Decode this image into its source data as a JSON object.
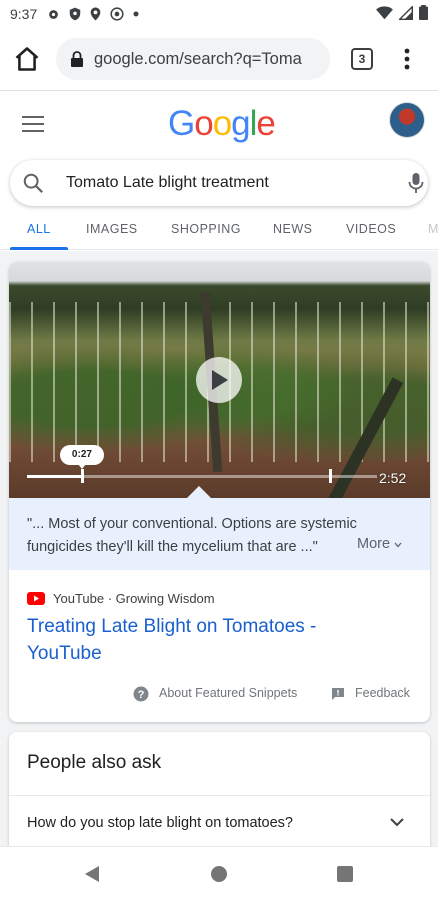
{
  "status_bar": {
    "time": "9:37",
    "left_icons": [
      "gear-icon",
      "shield-icon",
      "location-icon",
      "accessibility-icon",
      "dot-icon"
    ],
    "right_icons": [
      "wifi-icon",
      "signal-icon",
      "battery-icon"
    ]
  },
  "browser": {
    "url": "google.com/search?q=Toma",
    "tab_count": "3",
    "icons": [
      "home-icon",
      "lock-icon",
      "more-vert-icon"
    ]
  },
  "google": {
    "logo_letters": [
      "G",
      "o",
      "o",
      "g",
      "l",
      "e"
    ],
    "search_query": "Tomato Late blight treatment"
  },
  "tabs": [
    {
      "label": "ALL",
      "active": true
    },
    {
      "label": "IMAGES",
      "active": false
    },
    {
      "label": "SHOPPING",
      "active": false
    },
    {
      "label": "NEWS",
      "active": false
    },
    {
      "label": "VIDEOS",
      "active": false
    },
    {
      "label": "M",
      "active": false
    }
  ],
  "featured_snippet": {
    "video": {
      "current_time": "0:27",
      "duration": "2:52",
      "progress_fraction": 0.157,
      "clip_end_fraction": 0.865
    },
    "snippet_text_line1": "\"... Most of your conventional. Options are systemic",
    "snippet_text_line2": "fungicides they'll kill the mycelium that are ...\"",
    "more_label": "More",
    "source": "YouTube · Growing Wisdom",
    "title_line1": "Treating Late Blight on Tomatoes -",
    "title_line2": "YouTube",
    "about_label": "About Featured Snippets",
    "feedback_label": "Feedback"
  },
  "people_also_ask": {
    "title": "People also ask",
    "questions": [
      "How do you stop late blight on tomatoes?"
    ]
  },
  "colors": {
    "link": "#1a5fd0",
    "active_tab": "#1a73e8",
    "snippet_bg": "#e8f0fe",
    "youtube_red": "#ff0000"
  }
}
